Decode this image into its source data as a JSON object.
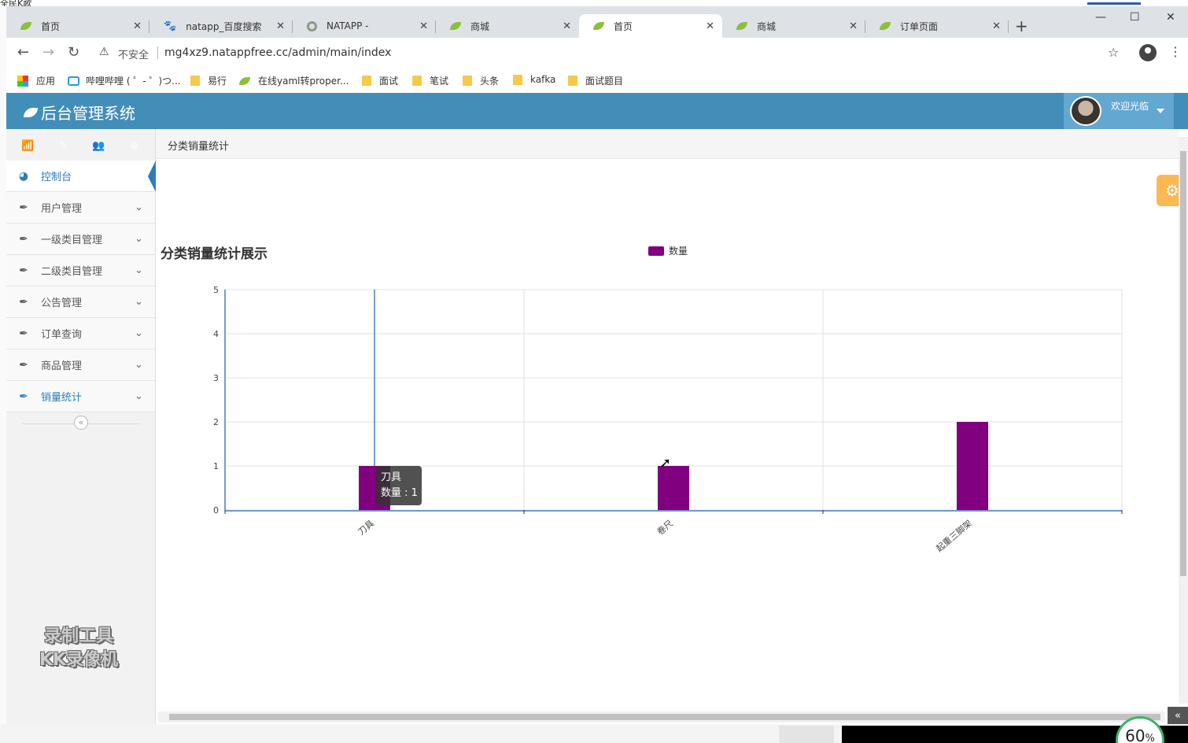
{
  "desktop": {
    "corner_text": "全民K歌",
    "zoom_percent": "60",
    "zoom_unit": "%"
  },
  "browser": {
    "tabs": [
      {
        "title": "首页",
        "active": false
      },
      {
        "title": "natapp_百度搜索",
        "active": false
      },
      {
        "title": "NATAPP -",
        "active": false
      },
      {
        "title": "商城",
        "active": false
      },
      {
        "title": "首页",
        "active": true
      },
      {
        "title": "商城",
        "active": false
      },
      {
        "title": "订单页面",
        "active": false
      }
    ],
    "address": {
      "warning": "不安全",
      "url": "mg4xz9.natappfree.cc/admin/main/index"
    },
    "bookmarks": [
      "应用",
      "哔哩哔哩 ( ゜- ゜)つ...",
      "易行",
      "在线yaml转proper...",
      "面试",
      "笔试",
      "头条",
      "kafka",
      "面试题目"
    ]
  },
  "app": {
    "brand": "后台管理系统",
    "user": {
      "welcome": "欢迎光临"
    },
    "shortcut_colors": [
      "#87b87f",
      "#6fb3e0",
      "#ffb752",
      "#d15b47"
    ],
    "nav": [
      {
        "label": "控制台",
        "active": true
      },
      {
        "label": "用户管理"
      },
      {
        "label": "一级类目管理"
      },
      {
        "label": "二级类目管理"
      },
      {
        "label": "公告管理"
      },
      {
        "label": "订单查询"
      },
      {
        "label": "商品管理"
      },
      {
        "label": "销量统计"
      }
    ],
    "breadcrumb": "分类销量统计",
    "watermark": [
      "录制工具",
      "KK录像机"
    ]
  },
  "chart_data": {
    "type": "bar",
    "title": "分类销量统计展示",
    "categories": [
      "刀具",
      "卷尺",
      "起重三脚架"
    ],
    "series": [
      {
        "name": "数量",
        "values": [
          1,
          1,
          2
        ],
        "color": "#800080"
      }
    ],
    "ylim": [
      0,
      5
    ],
    "yticks": [
      0,
      1,
      2,
      3,
      4,
      5
    ],
    "grid": true,
    "legend_position": "top-center",
    "tooltip": {
      "category": "刀具",
      "label": "数量 : 1"
    }
  }
}
